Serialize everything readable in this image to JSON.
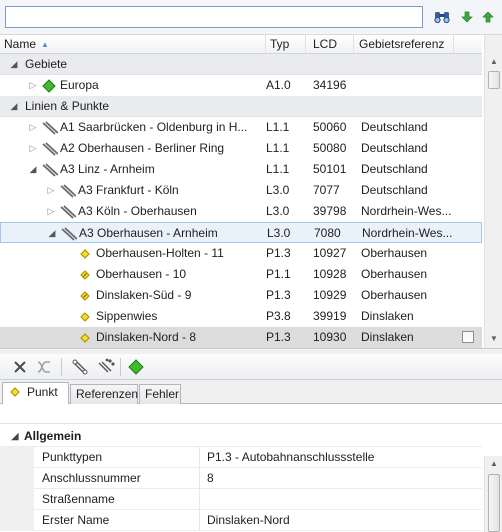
{
  "search": {
    "value": "",
    "placeholder": ""
  },
  "toolbar_icons": [
    "binoculars-icon",
    "arrow-down-icon",
    "arrow-up-icon"
  ],
  "columns": {
    "name": "Name",
    "typ": "Typ",
    "lcd": "LCD",
    "geo": "Gebietsreferenz"
  },
  "rows": [
    {
      "kind": "group",
      "expanded": true,
      "name": "Gebiete"
    },
    {
      "kind": "item",
      "level": 1,
      "expander": "closed",
      "icon": "area-icon",
      "name": "Europa",
      "typ": "A1.0",
      "lcd": "34196",
      "geo": ""
    },
    {
      "kind": "group",
      "expanded": true,
      "name": "Linien & Punkte"
    },
    {
      "kind": "item",
      "level": 1,
      "expander": "closed",
      "icon": "road-icon",
      "name": "A1 Saarbrücken - Oldenburg in H...",
      "typ": "L1.1",
      "lcd": "50060",
      "geo": "Deutschland"
    },
    {
      "kind": "item",
      "level": 1,
      "expander": "closed",
      "icon": "road-icon",
      "name": "A2 Oberhausen - Berliner Ring",
      "typ": "L1.1",
      "lcd": "50080",
      "geo": "Deutschland"
    },
    {
      "kind": "item",
      "level": 1,
      "expander": "open",
      "icon": "road-icon",
      "name": "A3 Linz - Arnheim",
      "typ": "L1.1",
      "lcd": "50101",
      "geo": "Deutschland"
    },
    {
      "kind": "item",
      "level": 2,
      "expander": "closed",
      "icon": "road-icon",
      "name": "A3 Frankfurt - Köln",
      "typ": "L3.0",
      "lcd": "7077",
      "geo": "Deutschland"
    },
    {
      "kind": "item",
      "level": 2,
      "expander": "closed",
      "icon": "road-icon",
      "name": "A3 Köln - Oberhausen",
      "typ": "L3.0",
      "lcd": "39798",
      "geo": "Nordrhein-Wes..."
    },
    {
      "kind": "item",
      "level": 2,
      "expander": "open",
      "icon": "road-icon",
      "name": "A3 Oberhausen - Arnheim",
      "typ": "L3.0",
      "lcd": "7080",
      "geo": "Nordrhein-Wes...",
      "state": "selected"
    },
    {
      "kind": "item",
      "level": 3,
      "expander": "none",
      "icon": "point-icon",
      "name": "Oberhausen-Holten - 11",
      "typ": "P1.3",
      "lcd": "10927",
      "geo": "Oberhausen"
    },
    {
      "kind": "item",
      "level": 3,
      "expander": "none",
      "icon": "junction-icon",
      "name": "Oberhausen - 10",
      "typ": "P1.1",
      "lcd": "10928",
      "geo": "Oberhausen"
    },
    {
      "kind": "item",
      "level": 3,
      "expander": "none",
      "icon": "junction-icon",
      "name": "Dinslaken-Süd - 9",
      "typ": "P1.3",
      "lcd": "10929",
      "geo": "Oberhausen"
    },
    {
      "kind": "item",
      "level": 3,
      "expander": "none",
      "icon": "point-icon",
      "name": "Sippenwies",
      "typ": "P3.8",
      "lcd": "39919",
      "geo": "Dinslaken"
    },
    {
      "kind": "item",
      "level": 3,
      "expander": "none",
      "icon": "point-icon",
      "name": "Dinslaken-Nord - 8",
      "typ": "P1.3",
      "lcd": "10930",
      "geo": "Dinslaken",
      "state": "active",
      "checkbox": true
    }
  ],
  "toolbar2_icons": [
    "delete-icon",
    "split-icon",
    "route-link-icon",
    "route-multi-icon",
    "area-add-icon"
  ],
  "tabs": [
    {
      "label": "Punkt",
      "icon": "point-icon",
      "active": true
    },
    {
      "label": "Referenzen",
      "active": false
    },
    {
      "label": "Fehler",
      "active": false
    }
  ],
  "properties": {
    "category": "Allgemein",
    "items": [
      {
        "name": "Punkttypen",
        "value": "P1.3 - Autobahnanschlussstelle"
      },
      {
        "name": "Anschlussnummer",
        "value": "8"
      },
      {
        "name": "Straßenname",
        "value": ""
      },
      {
        "name": "Erster Name",
        "value": "Dinslaken-Nord"
      }
    ]
  },
  "colors": {
    "selection_border": "#a7c5ec",
    "selection_fill": "#e9f1fb",
    "area_green": "#3fba2e",
    "point_yellow": "#f5df1e",
    "nav_green": "#3aa83a"
  }
}
